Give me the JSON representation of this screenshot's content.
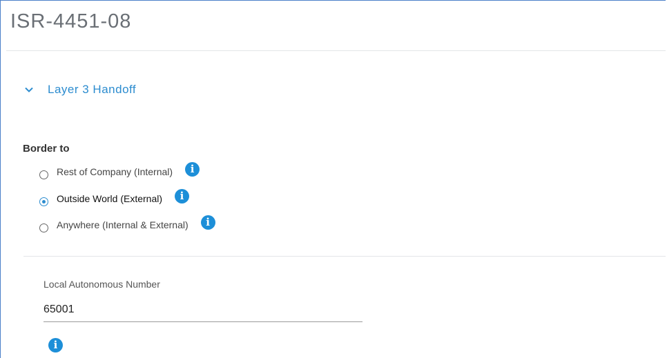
{
  "header": {
    "title": "ISR-4451-08"
  },
  "section": {
    "label": "Layer 3 Handoff",
    "toggle_icon": "chevron-down-icon",
    "expanded": true
  },
  "border_to": {
    "label": "Border to",
    "options": [
      {
        "label": "Rest of Company (Internal)",
        "selected": false,
        "info_icon": "i"
      },
      {
        "label": "Outside World (External)",
        "selected": true,
        "info_icon": "i"
      },
      {
        "label": "Anywhere (Internal & External)",
        "selected": false,
        "info_icon": "i"
      }
    ]
  },
  "local_as": {
    "label": "Local Autonomous Number",
    "value": "65001",
    "info_icon": "i"
  },
  "colors": {
    "accent": "#2c8ccf",
    "info_badge": "#1d8fd8",
    "title_text": "#6a6f75"
  }
}
